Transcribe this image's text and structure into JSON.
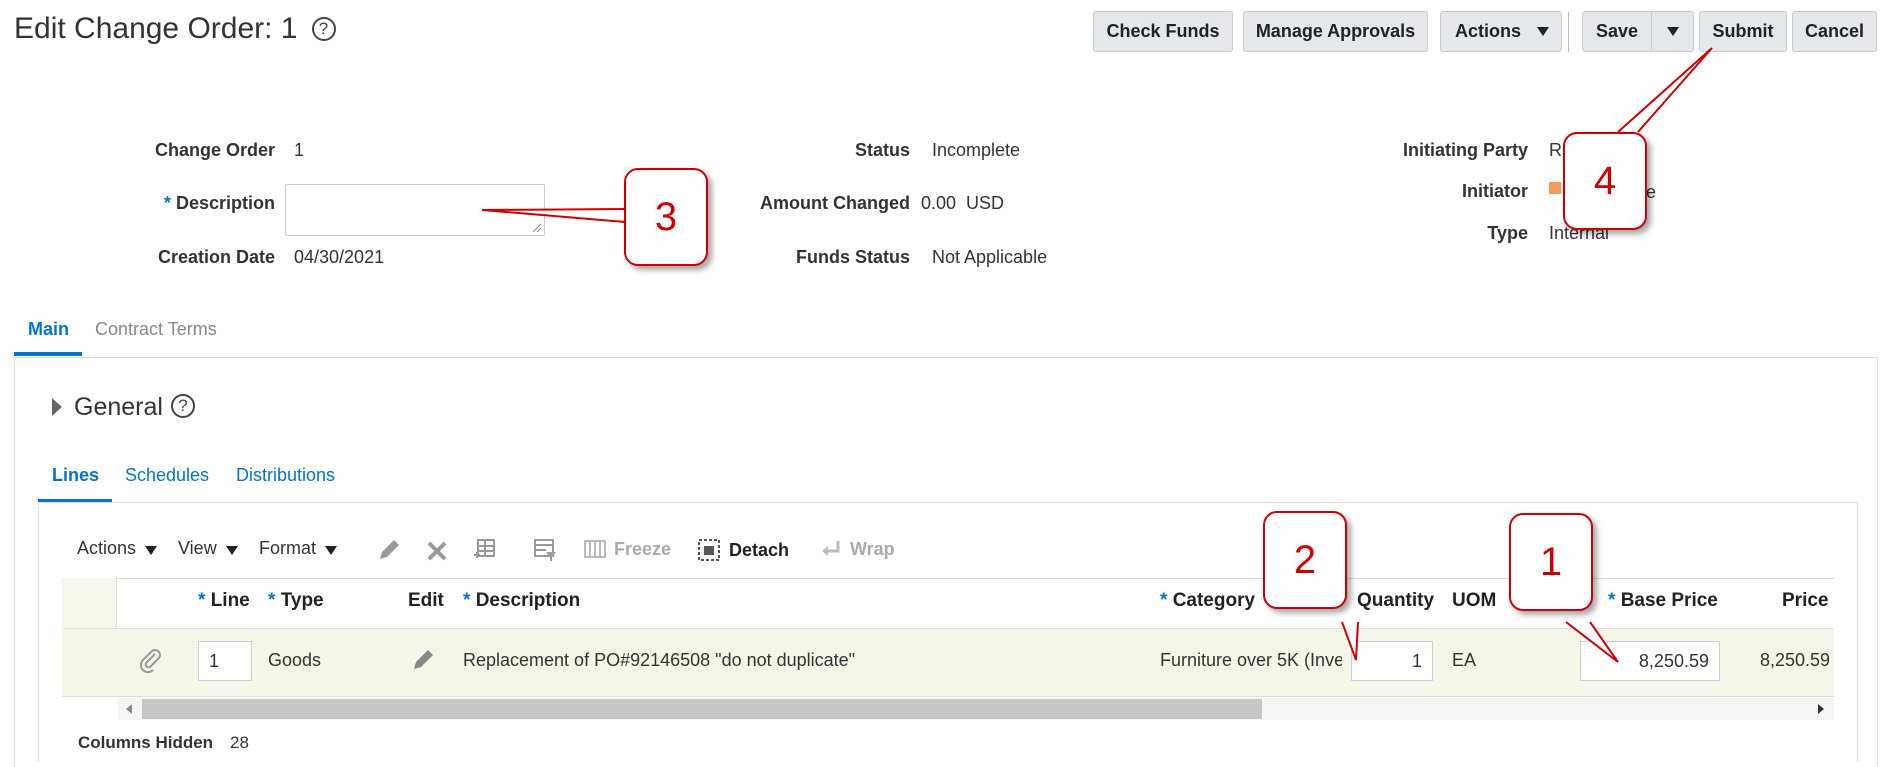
{
  "header": {
    "title": "Edit Change Order: 1",
    "help_glyph": "?",
    "buttons": {
      "check_funds": "Check Funds",
      "manage_approvals": "Manage Approvals",
      "actions": "Actions",
      "save": "Save",
      "submit": "Submit",
      "cancel": "Cancel"
    }
  },
  "form": {
    "change_order_label": "Change Order",
    "change_order_value": "1",
    "description_label": "Description",
    "required_mark": "*",
    "description_value": "",
    "creation_date_label": "Creation Date",
    "creation_date_value": "04/30/2021",
    "status_label": "Status",
    "status_value": "Incomplete",
    "amount_changed_label": "Amount Changed",
    "amount_changed_value": "0.00  USD",
    "funds_status_label": "Funds Status",
    "funds_status_value": "Not Applicable",
    "initiating_party_label": "Initiating Party",
    "initiating_party_value": "R",
    "initiator_label": "Initiator",
    "initiator_value": "e",
    "type_label": "Type",
    "type_value": "Internal"
  },
  "tabs": {
    "main": "Main",
    "contract_terms": "Contract Terms"
  },
  "general": {
    "title": "General"
  },
  "subtabs": {
    "lines": "Lines",
    "schedules": "Schedules",
    "distributions": "Distributions"
  },
  "toolbar": {
    "actions": "Actions",
    "view": "View",
    "format": "Format",
    "freeze": "Freeze",
    "detach": "Detach",
    "wrap": "Wrap"
  },
  "table": {
    "columns": {
      "line": "Line",
      "type": "Type",
      "edit": "Edit",
      "description": "Description",
      "category": "Category",
      "quantity": "Quantity",
      "uom": "UOM",
      "base_price": "Base Price",
      "price": "Price"
    },
    "rows": [
      {
        "line": "1",
        "type": "Goods",
        "description": "Replacement of PO#92146508 \"do not duplicate\"",
        "category": "Furniture over 5K (Inve",
        "quantity": "1",
        "uom": "EA",
        "base_price": "8,250.59",
        "price": "8,250.59"
      }
    ],
    "columns_hidden_label": "Columns Hidden",
    "columns_hidden_value": "28"
  },
  "callouts": {
    "c1": "1",
    "c2": "2",
    "c3": "3",
    "c4": "4"
  },
  "colors": {
    "accent": "#0572ce",
    "callout": "#cc0000",
    "row_highlight": "#f4f6e8"
  }
}
